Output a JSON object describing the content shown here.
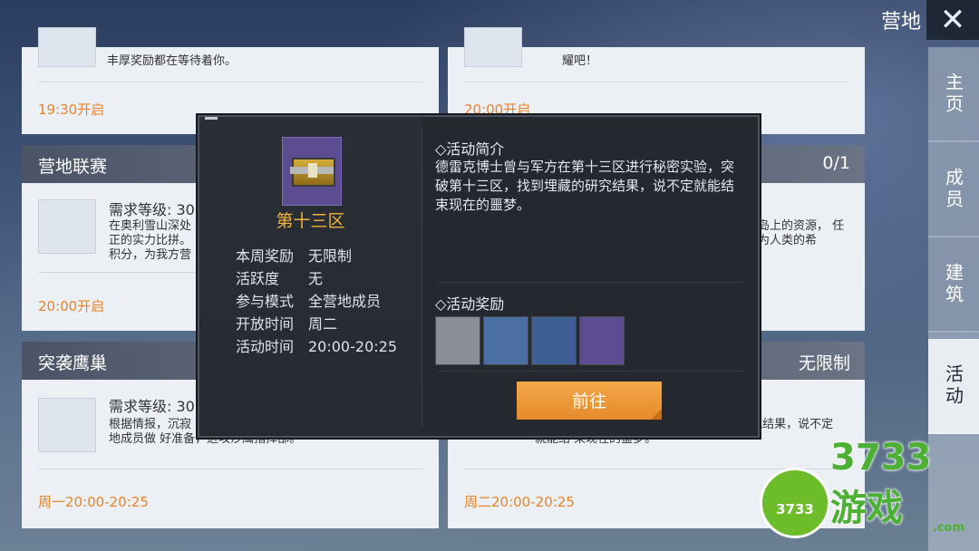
{
  "header": {
    "title": "营地",
    "close_icon": "close-icon"
  },
  "sidenav": {
    "items": [
      "主页",
      "成员",
      "建筑",
      "活动"
    ],
    "active": "活动"
  },
  "cards": {
    "top_left": {
      "desc": "丰厚奖励都在等待着你。",
      "time": "19:30开启"
    },
    "top_right": {
      "desc": "耀吧！",
      "time": "20:00开启"
    },
    "mid_left": {
      "title": "营地联赛",
      "req": "需求等级: 30",
      "desc": "在奥利雪山深处 正的实力比拼。 积分，为我方营",
      "time": "20:00开启"
    },
    "mid_right": {
      "count": "0/1",
      "desc": "岛上的资源， 任为人类的希"
    },
    "bot_left": {
      "title": "突袭鹰巢",
      "req": "需求等级: 30",
      "desc": "根据情报，沉寂 行武装集结，准备要挑起事端，请各位营地成员做 好准备，进攻沙鹰指挥部。",
      "time": "周一20:00-20:25"
    },
    "bot_right": {
      "badge": "无限制",
      "desc": "秘密实验，突 破第十三区，找到埋藏的研究结果，说不定就能结 束现在的噩梦。",
      "time": "周二20:00-20:25"
    }
  },
  "modal": {
    "item_name": "第十三区",
    "info": [
      {
        "key": "本周奖励",
        "value": "无限制"
      },
      {
        "key": "活跃度",
        "value": "无"
      },
      {
        "key": "参与模式",
        "value": "全营地成员"
      },
      {
        "key": "开放时间",
        "value": "周二"
      },
      {
        "key": "活动时间",
        "value": "20:00-20:25"
      }
    ],
    "intro_title": "◇活动简介",
    "intro_text": "德雷克博士曾与军方在第十三区进行秘密实验，突破第十三区，找到埋藏的研究结果，说不定就能结束现在的噩梦。",
    "reward_title": "◇活动奖励",
    "rewards": [
      "silver-coin-icon",
      "armor-piece-icon",
      "blueprint-icon",
      "supply-box-icon"
    ],
    "go_button": "前往"
  },
  "watermark": {
    "circle": "3733",
    "text": "3733游戏",
    "domain": ".com"
  },
  "colors": {
    "accent": "#e8852a",
    "gold": "#f2b43a",
    "modal_bg": "#25282f",
    "button": "#f09a3a"
  }
}
